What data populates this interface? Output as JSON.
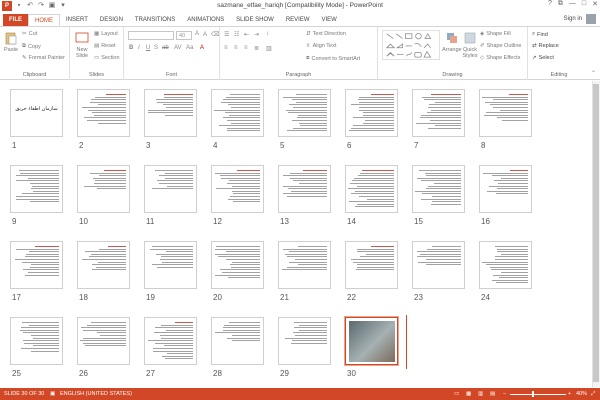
{
  "window": {
    "title": "sazmane_etfae_hariqh [Compatibility Mode] - PowerPoint",
    "app_icon": "P",
    "controls": [
      "?",
      "⧉",
      "—",
      "□",
      "✕"
    ],
    "sign_in": "Sign in"
  },
  "tabs": [
    "FILE",
    "HOME",
    "INSERT",
    "DESIGN",
    "TRANSITIONS",
    "ANIMATIONS",
    "SLIDE SHOW",
    "REVIEW",
    "VIEW"
  ],
  "active_tab": "HOME",
  "ribbon": {
    "clipboard": {
      "label": "Clipboard",
      "paste": "Paste",
      "cut": "Cut",
      "copy": "Copy",
      "format_painter": "Format Painter"
    },
    "slides": {
      "label": "Slides",
      "new_slide": "New Slide",
      "layout": "Layout",
      "reset": "Reset",
      "section": "Section"
    },
    "font": {
      "label": "Font",
      "font_name": "",
      "font_size": "40"
    },
    "paragraph": {
      "label": "Paragraph",
      "text_direction": "Text Direction",
      "align_text": "Align Text",
      "convert": "Convert to SmartArt"
    },
    "drawing": {
      "label": "Drawing",
      "arrange": "Arrange",
      "quick_styles": "Quick Styles",
      "shape_fill": "Shape Fill",
      "shape_outline": "Shape Outline",
      "shape_effects": "Shape Effects"
    },
    "editing": {
      "label": "Editing",
      "find": "Find",
      "replace": "Replace",
      "select": "Select"
    }
  },
  "slides": {
    "count": 30,
    "selected": 30,
    "title_slide_text": "سازمان اطفاء حريق"
  },
  "status": {
    "slide_indicator": "SLIDE 30 OF 30",
    "language": "ENGLISH (UNITED STATES)",
    "zoom": "40%",
    "zoom_fraction": 0.4
  },
  "colors": {
    "accent": "#d24726",
    "text": "#444444"
  }
}
